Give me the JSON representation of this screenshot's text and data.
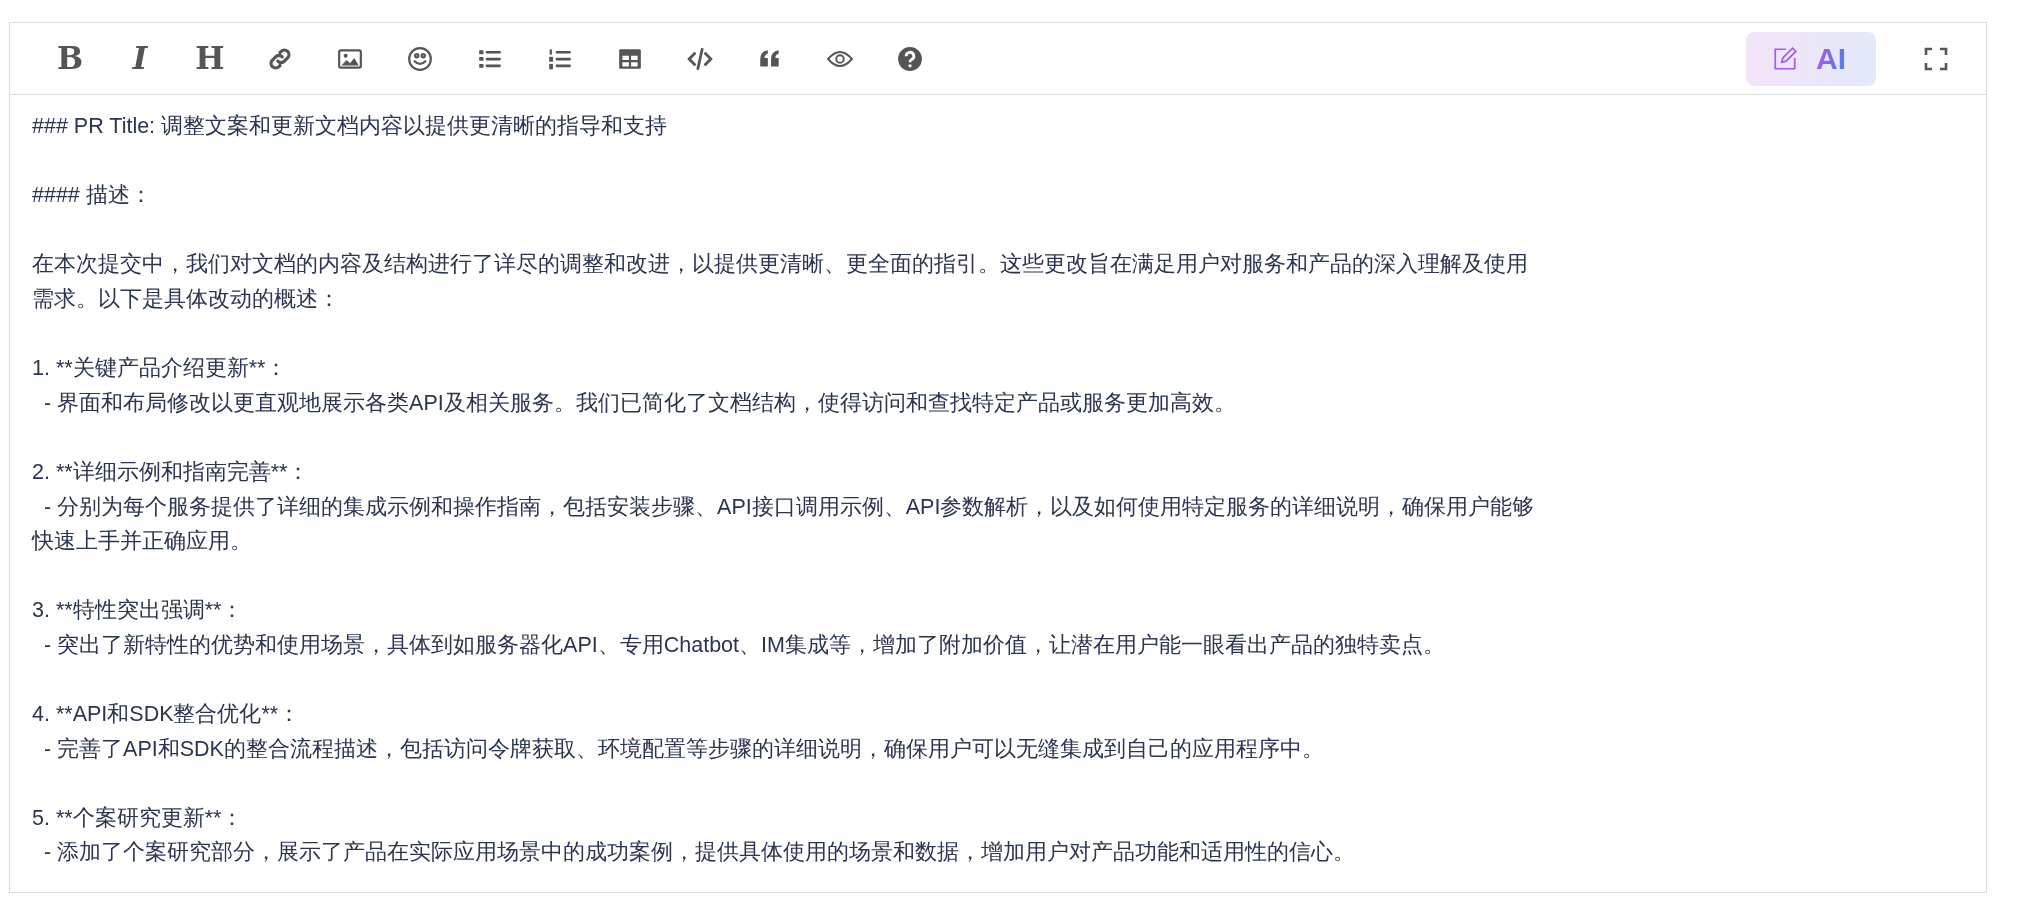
{
  "toolbar": [
    {
      "kind": "bold",
      "label": "B"
    },
    {
      "kind": "italic",
      "label": "I"
    },
    {
      "kind": "heading",
      "label": "H"
    },
    {
      "kind": "link"
    },
    {
      "kind": "image"
    },
    {
      "kind": "emoji"
    },
    {
      "kind": "bullet-list"
    },
    {
      "kind": "numbered-list"
    },
    {
      "kind": "table"
    },
    {
      "kind": "code"
    },
    {
      "kind": "quote"
    },
    {
      "kind": "preview"
    },
    {
      "kind": "help"
    }
  ],
  "ai_button": {
    "label": "AI"
  },
  "content": [
    [
      "### PR Title: 调整文案和更新文档内容以提供更清晰的指导和支持"
    ],
    [
      "#### 描述："
    ],
    [
      "在本次提交中，我们对文档的内容及结构进行了详尽的调整和改进，以提供更清晰、更全面的指引。这些更改旨在满足用户对服务和产品的深入理解及使用",
      "需求。以下是具体改动的概述："
    ],
    [
      "1. **关键产品介绍更新**：",
      "  - 界面和布局修改以更直观地展示各类API及相关服务。我们已简化了文档结构，使得访问和查找特定产品或服务更加高效。"
    ],
    [
      "2. **详细示例和指南完善**：",
      "  - 分别为每个服务提供了详细的集成示例和操作指南，包括安装步骤、API接口调用示例、API参数解析，以及如何使用特定服务的详细说明，确保用户能够",
      "快速上手并正确应用。"
    ],
    [
      "3. **特性突出强调**：",
      "  - 突出了新特性的优势和使用场景，具体到如服务器化API、专用Chatbot、IM集成等，增加了附加价值，让潜在用户能一眼看出产品的独特卖点。"
    ],
    [
      "4. **API和SDK整合优化**：",
      "  - 完善了API和SDK的整合流程描述，包括访问令牌获取、环境配置等步骤的详细说明，确保用户可以无缝集成到自己的应用程序中。"
    ],
    [
      "5. **个案研究更新**：",
      "  - 添加了个案研究部分，展示了产品在实际应用场景中的成功案例，提供具体使用的场景和数据，增加用户对产品功能和适用性的信心。"
    ]
  ]
}
